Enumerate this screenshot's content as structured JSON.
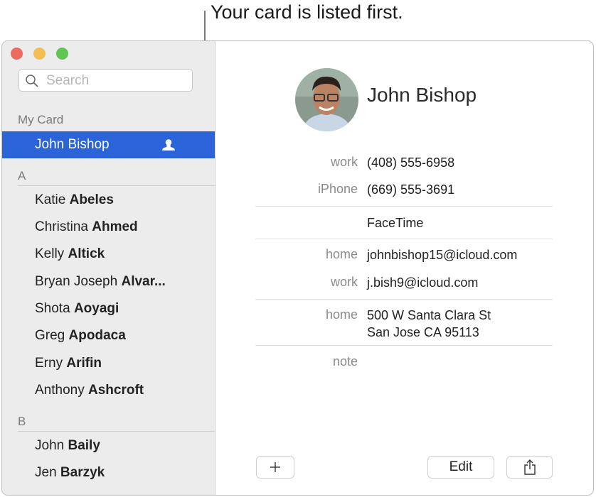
{
  "callout": {
    "text": "Your card is listed first."
  },
  "search": {
    "placeholder": "Search",
    "value": ""
  },
  "sidebar": {
    "my_card_label": "My Card",
    "my_card": {
      "first": "John",
      "last": "Bishop"
    },
    "sections": [
      {
        "letter": "A",
        "contacts": [
          {
            "first": "Katie",
            "last": "Abeles"
          },
          {
            "first": "Christina",
            "last": "Ahmed"
          },
          {
            "first": "Kelly",
            "last": "Altick"
          },
          {
            "first": "Bryan Joseph",
            "last": "Alvar..."
          },
          {
            "first": "Shota",
            "last": "Aoyagi"
          },
          {
            "first": "Greg",
            "last": "Apodaca"
          },
          {
            "first": "Erny",
            "last": "Arifin"
          },
          {
            "first": "Anthony",
            "last": "Ashcroft"
          }
        ]
      },
      {
        "letter": "B",
        "contacts": [
          {
            "first": "John",
            "last": "Baily"
          },
          {
            "first": "Jen",
            "last": "Barzyk"
          }
        ]
      }
    ]
  },
  "card": {
    "name": "John Bishop",
    "phones": [
      {
        "label": "work",
        "value": "(408) 555-6958"
      },
      {
        "label": "iPhone",
        "value": "(669) 555-3691"
      }
    ],
    "facetime": "FaceTime",
    "emails": [
      {
        "label": "home",
        "value": "johnbishop15@icloud.com"
      },
      {
        "label": "work",
        "value": "j.bish9@icloud.com"
      }
    ],
    "address": {
      "label": "home",
      "line1": "500 W Santa Clara St",
      "line2": "San Jose CA 95113"
    },
    "note_label": "note"
  },
  "buttons": {
    "add": "+",
    "edit": "Edit",
    "share_icon": "share-icon"
  },
  "colors": {
    "selection": "#2a64d8",
    "close": "#ed6a5e",
    "minimize": "#f5bf4f",
    "zoom": "#61c554"
  }
}
